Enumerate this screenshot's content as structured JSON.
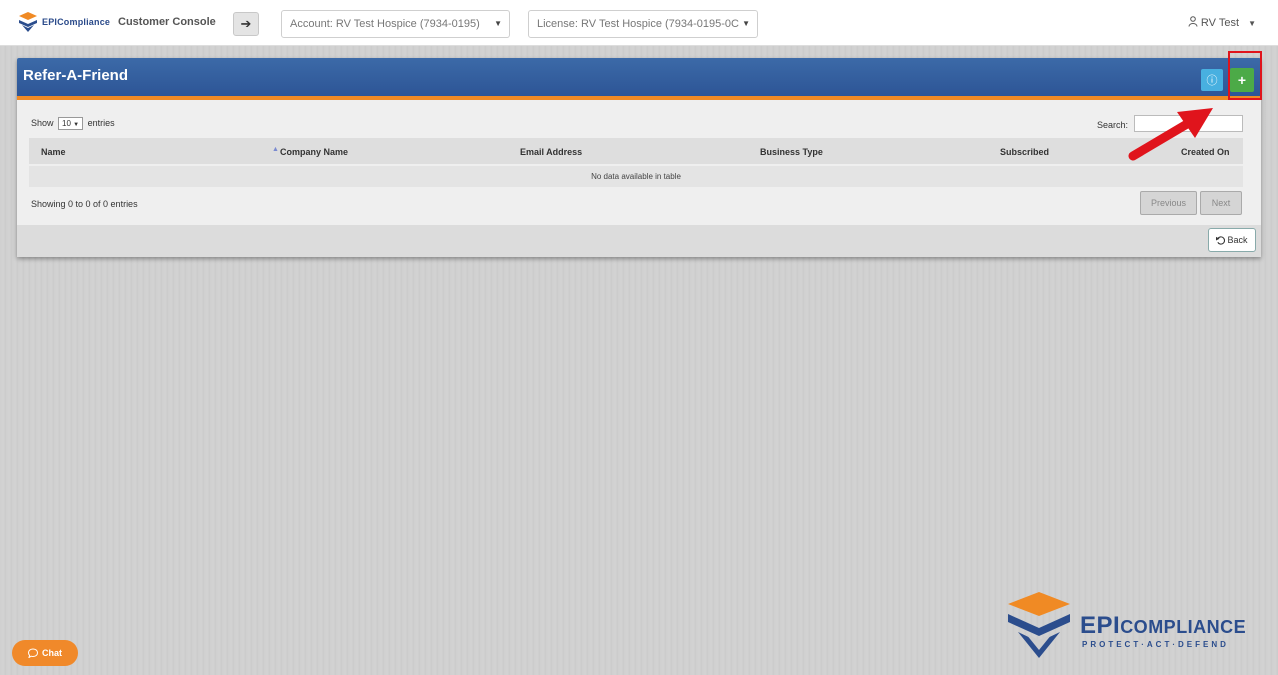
{
  "header": {
    "brand_text": "EPICompliance",
    "console_title": "Customer Console",
    "nav_arrow": "➔",
    "account_select": "Account: RV Test Hospice (7934-0195)",
    "license_select": "License: RV Test Hospice (7934-0195-0C",
    "user_name": "RV Test"
  },
  "panel": {
    "title": "Refer-A-Friend",
    "info_icon": "ⓘ",
    "add_icon": "+",
    "length": {
      "show_label": "Show",
      "value": "10",
      "entries_label": "entries"
    },
    "search_label": "Search:",
    "columns": [
      "Name",
      "Company Name",
      "Email Address",
      "Business Type",
      "Subscribed",
      "Created On"
    ],
    "empty_message": "No data available in table",
    "info_text": "Showing 0 to 0 of 0 entries",
    "previous_label": "Previous",
    "next_label": "Next",
    "back_label": "Back"
  },
  "chat_label": "Chat",
  "footer_logo": {
    "brand_big": "EPI",
    "brand_rest": "COMPLIANCE",
    "tagline": "PROTECT·ACT·DEFEND"
  },
  "colors": {
    "header_blue": "#2d5596",
    "accent_orange": "#f08a24",
    "add_green": "#4caa47",
    "info_blue": "#48b0e0",
    "annotation_red": "#e0141c"
  }
}
